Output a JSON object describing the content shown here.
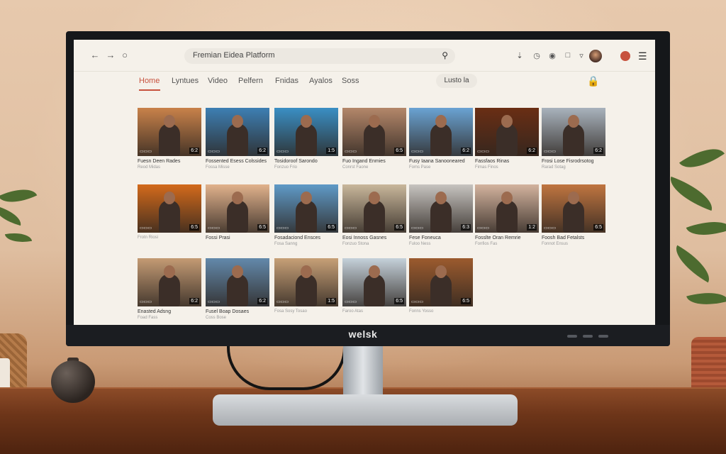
{
  "monitor": {
    "brand": "welsk"
  },
  "browser": {
    "search_text": "Fremian Eidea Platform",
    "nav_icons": [
      "back-icon",
      "forward-icon",
      "reload-icon"
    ],
    "tool_icons": [
      "download-icon",
      "history-icon",
      "extensions-icon",
      "bookmark-icon",
      "share-icon"
    ]
  },
  "tabs": [
    {
      "label": "Home",
      "active": true
    },
    {
      "label": "Lyntues",
      "active": false
    },
    {
      "label": "Video",
      "active": false
    },
    {
      "label": "Pelfern",
      "active": false
    },
    {
      "label": "Fnidas",
      "active": false
    },
    {
      "label": "Ayalos",
      "active": false
    },
    {
      "label": "Soss",
      "active": false
    }
  ],
  "sort_label": "Lusto la",
  "videos": [
    {
      "title": "Fuesn Deen Rades",
      "meta": "Reod Midas",
      "duration": "6:2"
    },
    {
      "title": "Fossented Esess Colssides",
      "meta": "Fossa Misse",
      "duration": "6:2"
    },
    {
      "title": "Tosidoroof Sarondo",
      "meta": "Fonzuo Frio",
      "duration": "1:5"
    },
    {
      "title": "Fuo Ingand Enmies",
      "meta": "Conrst Faone",
      "duration": "6:5"
    },
    {
      "title": "Fusy Iaana Sanooneared",
      "meta": "Foms Pase",
      "duration": "6:2"
    },
    {
      "title": "Fassfaos Rinas",
      "meta": "Fimas Finos",
      "duration": "6:2"
    },
    {
      "title": "Frosi Lose Fisrodrsotog",
      "meta": "Rarad Sotag",
      "duration": "6:2"
    },
    {
      "title": "",
      "meta": "Frotn Riosi",
      "duration": "6:5"
    },
    {
      "title": "Fossi Prasi",
      "meta": "",
      "duration": "6:5"
    },
    {
      "title": "Fosadaciond Ensces",
      "meta": "Fosa Sanng",
      "duration": "6:5"
    },
    {
      "title": "Eosi Innoss Gasnes",
      "meta": "Fonzuo Stona",
      "duration": "6:5"
    },
    {
      "title": "Fese Foneuca",
      "meta": "Fuloo Ness",
      "duration": "6:3"
    },
    {
      "title": "Fosslte Oran Remrie",
      "meta": "Fonfios Fas",
      "duration": "1:2"
    },
    {
      "title": "Foosh Bad Fetalsts",
      "meta": "Fonnot Ensus",
      "duration": "6:5"
    },
    {
      "title": "Enasted Adsng",
      "meta": "Foad Fass",
      "duration": "6:2"
    },
    {
      "title": "Fusel Boap Dosaes",
      "meta": "Coss Bose",
      "duration": "6:2"
    },
    {
      "title": "",
      "meta": "Fosa Sosy Tosao",
      "duration": "1:5"
    },
    {
      "title": "",
      "meta": "Faroo Atas",
      "duration": "6:5"
    },
    {
      "title": "",
      "meta": "Fonns Yosso",
      "duration": "6:5"
    }
  ],
  "thumb_colors": [
    "#c9824a",
    "#3d7fb3",
    "#3a8fc4",
    "#b4876a",
    "#6aa3d3",
    "#6a2e14",
    "#a9b3bd",
    "#d36a1b",
    "#e1b28c",
    "#5f9ac7",
    "#c9b79b",
    "#c7c4c0",
    "#d3b39e",
    "#c07540",
    "#c49b74",
    "#6389ab",
    "#c7a077",
    "#c5d1da",
    "#9c5b2e"
  ]
}
